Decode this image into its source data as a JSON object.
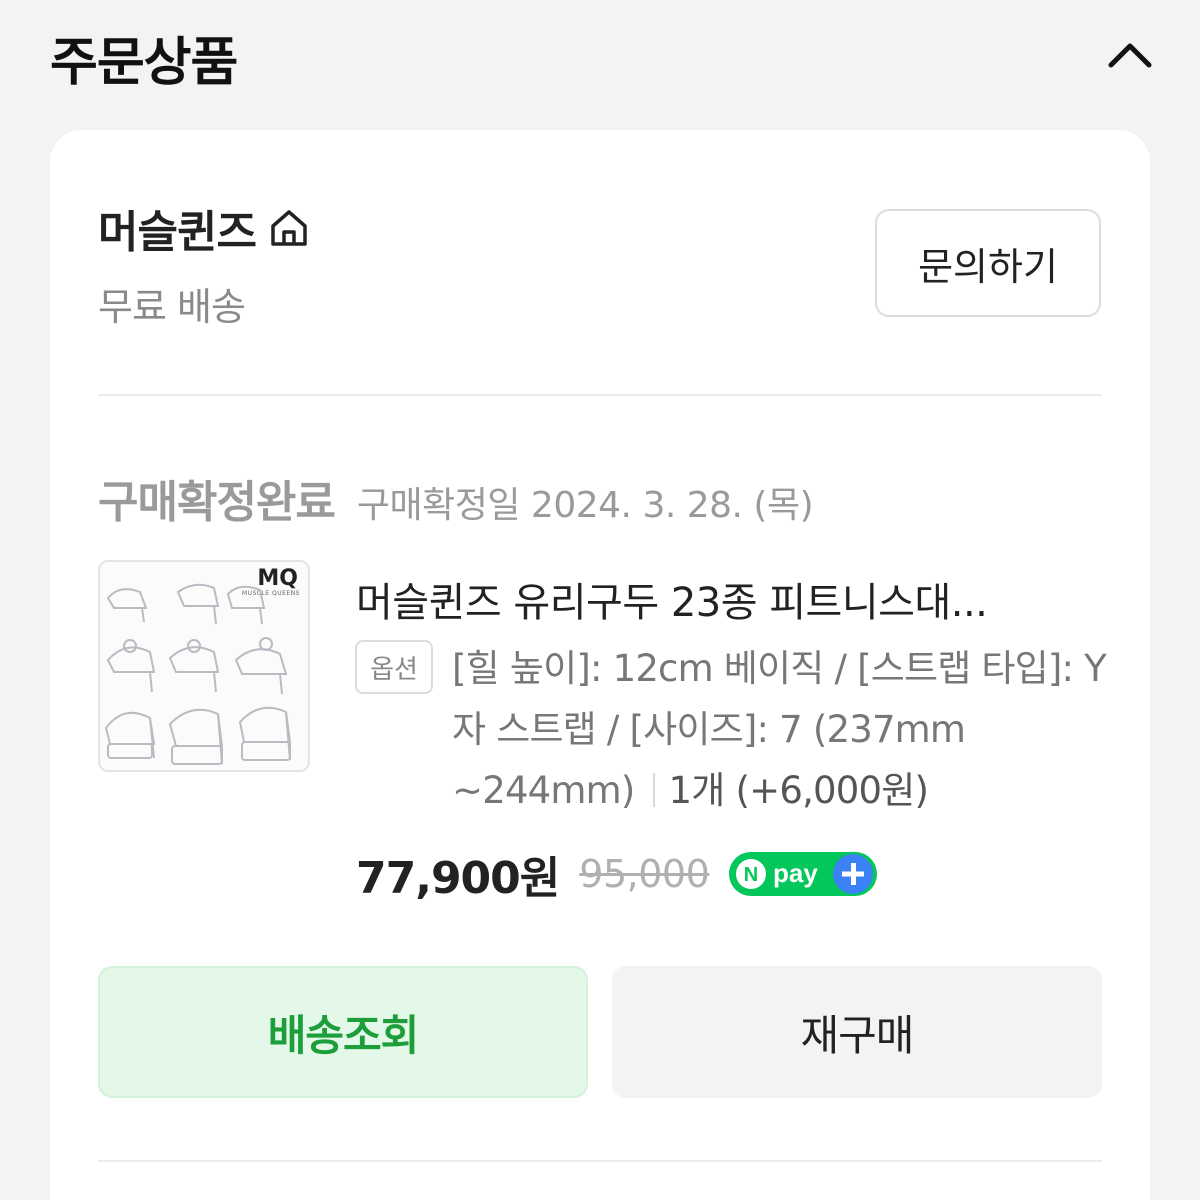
{
  "header": {
    "title": "주문상품",
    "collapse_icon": "chevron-up-icon"
  },
  "store": {
    "name": "머슬퀸즈",
    "home_icon": "home-icon",
    "shipping": "무료 배송",
    "inquiry_label": "문의하기"
  },
  "order": {
    "status": "구매확정완료",
    "confirm_date": "구매확정일 2024. 3. 28. (목)"
  },
  "product": {
    "thumbnail_logo": "MQ",
    "thumbnail_sub": "MUSCLE QUEENS",
    "name": "머슬퀸즈 유리구두 23종 피트니스대...",
    "option_badge": "옵션",
    "option_text": "[힐 높이]: 12cm 베이직 / [스트랩 타입]: Y자 스트랩 / [사이즈]: 7 (237mm ~244mm)",
    "quantity": "1개 (+6,000원)",
    "price": "77,900원",
    "original_price": "95,000",
    "pay_badge": "Npay+"
  },
  "actions": {
    "track_label": "배송조회",
    "rebuy_label": "재구매"
  },
  "colors": {
    "page_bg": "#f2f3f5",
    "card_bg": "#ffffff",
    "track_bg": "#e3f8e8",
    "track_text": "#1e9e3a",
    "npay_green": "#03c75a",
    "npay_blue": "#3b82f6"
  }
}
